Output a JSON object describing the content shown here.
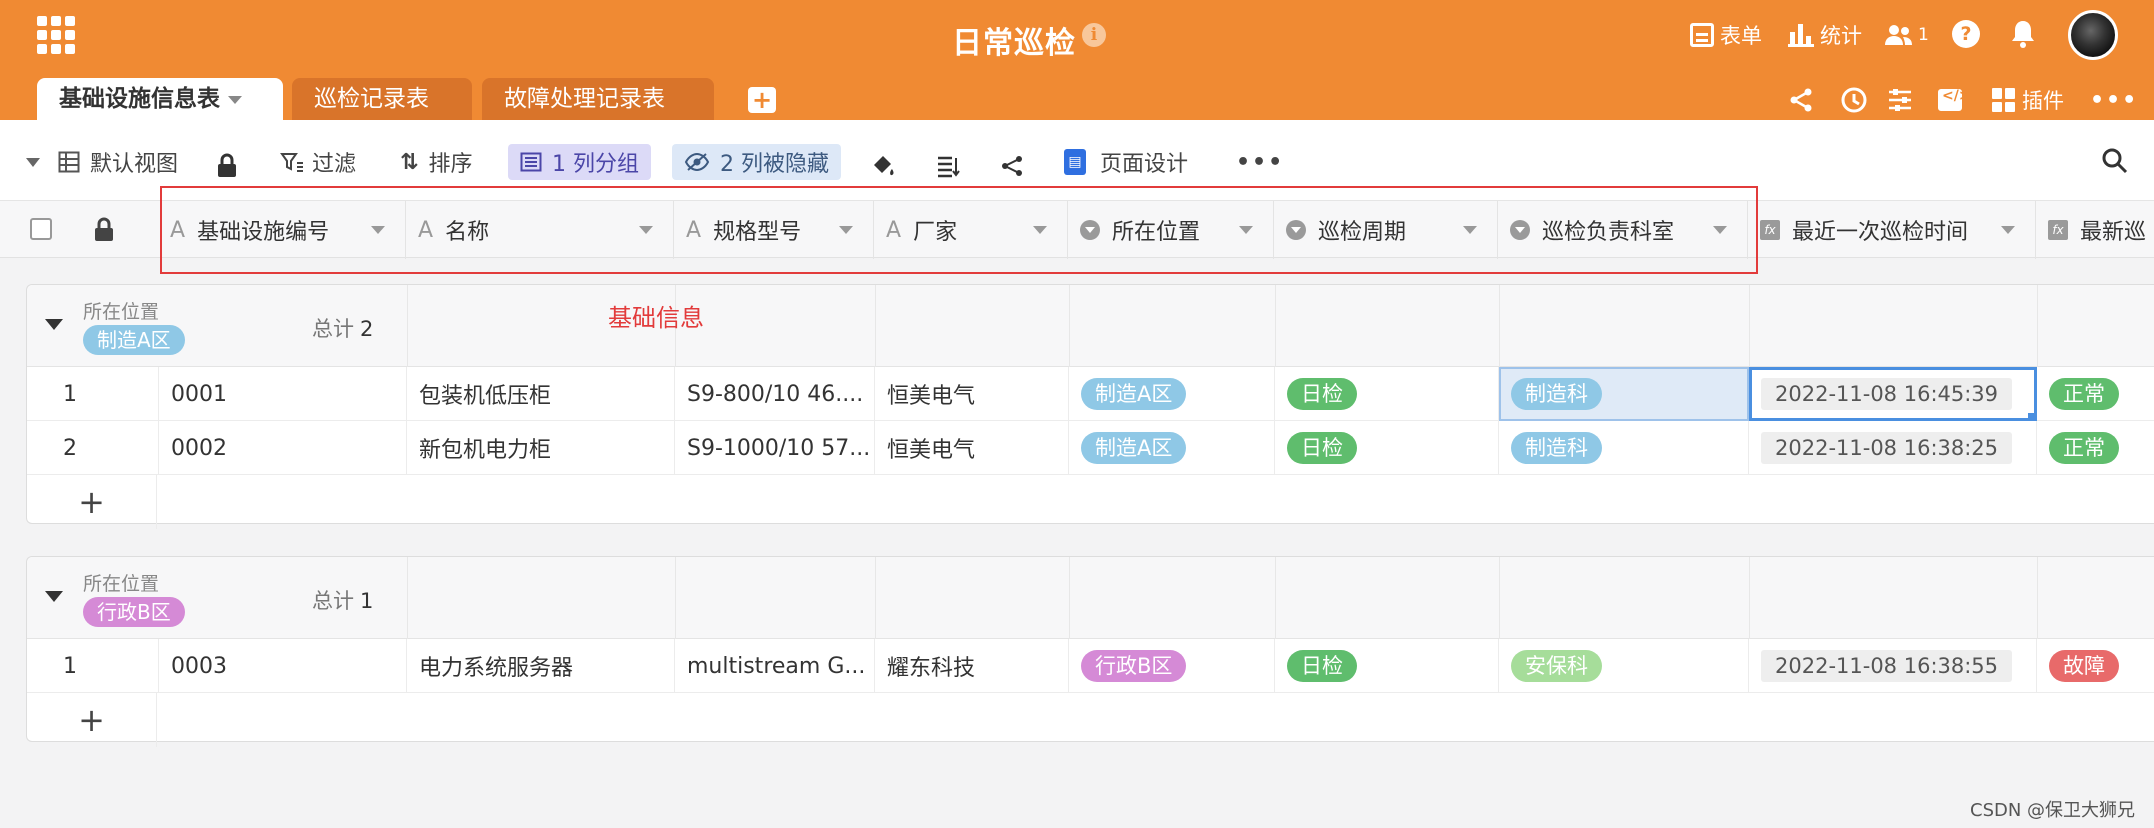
{
  "app": {
    "title": "日常巡检"
  },
  "header_right": {
    "form_label": "表单",
    "stat_label": "统计",
    "user_count": "1"
  },
  "tabs": [
    {
      "label": "基础设施信息表",
      "active": true
    },
    {
      "label": "巡检记录表",
      "active": false
    },
    {
      "label": "故障处理记录表",
      "active": false
    }
  ],
  "tabbar_right": {
    "plugin_label": "插件"
  },
  "toolbar": {
    "view_label": "默认视图",
    "filter_label": "过滤",
    "sort_label": "排序",
    "group_label": "1 列分组",
    "hidden_label": "2 列被隐藏",
    "page_design_label": "页面设计",
    "more_label": "•••"
  },
  "columns": [
    {
      "label": "基础设施编号",
      "type": "text"
    },
    {
      "label": "名称",
      "type": "text"
    },
    {
      "label": "规格型号",
      "type": "text"
    },
    {
      "label": "厂家",
      "type": "text"
    },
    {
      "label": "所在位置",
      "type": "select"
    },
    {
      "label": "巡检周期",
      "type": "select"
    },
    {
      "label": "巡检负责科室",
      "type": "select"
    },
    {
      "label": "最近一次巡检时间",
      "type": "formula"
    },
    {
      "label": "最新巡",
      "type": "formula"
    }
  ],
  "annotation": {
    "text": "基础信息",
    "color": "#e23b3b"
  },
  "groups": [
    {
      "label": "所在位置",
      "tag": "制造A区",
      "tag_color": "#8fc8e6",
      "count_label": "总计",
      "count": "2",
      "rows": [
        {
          "num": "1",
          "code": "0001",
          "name": "包装机低压柜",
          "model": "S9-800/10 46....",
          "maker": "恒美电气",
          "location": "制造A区",
          "cycle": "日检",
          "dept": "制造科",
          "last_time": "2022-11-08 16:45:39",
          "status": "正常"
        },
        {
          "num": "2",
          "code": "0002",
          "name": "新包机电力柜",
          "model": "S9-1000/10 57...",
          "maker": "恒美电气",
          "location": "制造A区",
          "cycle": "日检",
          "dept": "制造科",
          "last_time": "2022-11-08 16:38:25",
          "status": "正常"
        }
      ],
      "add_label": "+"
    },
    {
      "label": "所在位置",
      "tag": "行政B区",
      "tag_color": "#d58ad6",
      "count_label": "总计",
      "count": "1",
      "rows": [
        {
          "num": "1",
          "code": "0003",
          "name": "电力系统服务器",
          "model": "multistream G...",
          "maker": "耀东科技",
          "location": "行政B区",
          "cycle": "日检",
          "dept": "安保科",
          "last_time": "2022-11-08 16:38:55",
          "status": "故障"
        }
      ],
      "add_label": "+"
    }
  ],
  "watermark": "CSDN @保卫大狮兄",
  "colors": {
    "brand": "#f08a33",
    "tab_inactive": "#d9742a",
    "status_ok": "#5fbd6d",
    "status_fault": "#e86a6a"
  }
}
